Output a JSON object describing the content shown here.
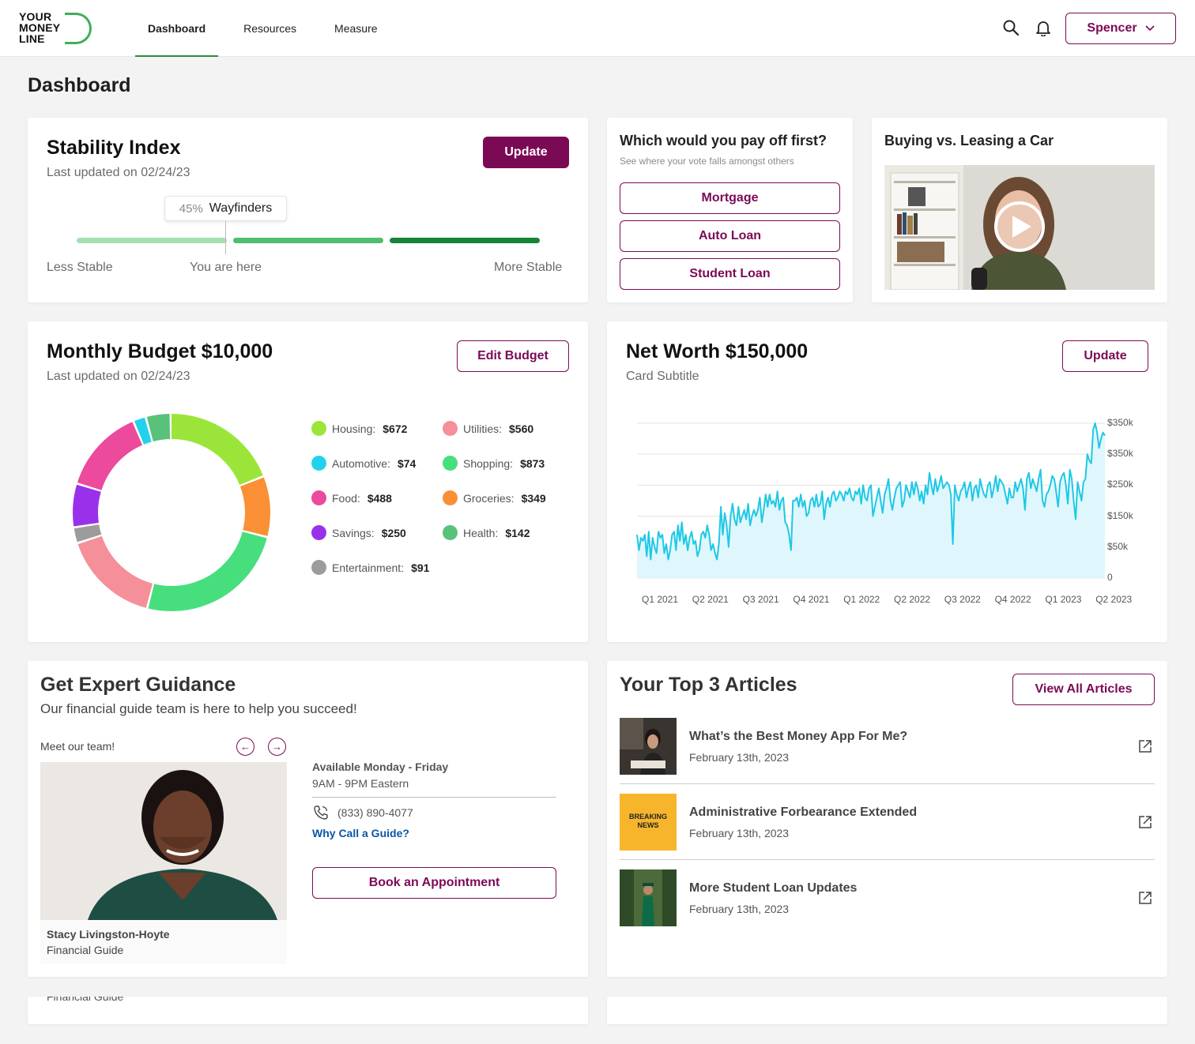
{
  "header": {
    "logo_lines": [
      "YOUR",
      "MONEY",
      "LINE"
    ],
    "nav": [
      "Dashboard",
      "Resources",
      "Measure"
    ],
    "user_name": "Spencer",
    "brand_color": "#7b0a55",
    "accent_color": "#2e8b46"
  },
  "page_title": "Dashboard",
  "stability": {
    "title": "Stability Index",
    "updated": "Last updated on 02/24/23",
    "button": "Update",
    "tooltip_pct": "45%",
    "tooltip_label": "Wayfinders",
    "position_fraction": 0.45,
    "less": "Less Stable",
    "here": "You are here",
    "more": "More Stable"
  },
  "vote": {
    "title": "Which would you pay off first?",
    "subtitle": "See where your vote falls amongst others",
    "options": [
      "Mortgage",
      "Auto Loan",
      "Student Loan"
    ]
  },
  "video": {
    "title": "Buying vs. Leasing a Car",
    "icon": "play-icon"
  },
  "budget": {
    "title": "Monthly Budget $10,000",
    "updated": "Last updated on 02/24/23",
    "button": "Edit Budget",
    "items": [
      {
        "label": "Housing:",
        "value": "$672",
        "color": "#9be53a"
      },
      {
        "label": "Utilities:",
        "value": "$560",
        "color": "#f58f9a"
      },
      {
        "label": "Automotive:",
        "value": "$74",
        "color": "#22d2ec"
      },
      {
        "label": "Shopping:",
        "value": "$873",
        "color": "#47df7d"
      },
      {
        "label": "Food:",
        "value": "$488",
        "color": "#ec4a9c"
      },
      {
        "label": "Groceries:",
        "value": "$349",
        "color": "#fa8f35"
      },
      {
        "label": "Savings:",
        "value": "$250",
        "color": "#9a31ea"
      },
      {
        "label": "Health:",
        "value": "$142",
        "color": "#58c27a"
      },
      {
        "label": "Entertainment:",
        "value": "$91",
        "color": "#9c9c9c"
      }
    ]
  },
  "networth": {
    "title": "Net Worth $150,000",
    "subtitle": "Card Subtitle",
    "button": "Update"
  },
  "chart_data": {
    "type": "area",
    "title": "",
    "xlabel": "",
    "ylabel": "",
    "x_ticks": [
      "Q1 2021",
      "Q2 2021",
      "Q3 2021",
      "Q4 2021",
      "Q1 2022",
      "Q2 2022",
      "Q3 2022",
      "Q4 2022",
      "Q1 2023",
      "Q2 2023"
    ],
    "y_tick_labels": [
      "0",
      "$50k",
      "$150k",
      "$250k",
      "$350k",
      "$350k"
    ],
    "y_tick_values": [
      0,
      50000,
      100000,
      150000,
      200000,
      250000
    ],
    "ylim": [
      0,
      255000
    ],
    "grid": true,
    "line_color": "#1fc8e6",
    "fill_color": "#dff7fc",
    "values": [
      70000,
      45000,
      65000,
      60000,
      70000,
      35000,
      75000,
      30000,
      65000,
      50000,
      40000,
      75000,
      65000,
      70000,
      40000,
      55000,
      30000,
      45000,
      70000,
      75000,
      45000,
      85000,
      60000,
      90000,
      55000,
      70000,
      45000,
      65000,
      75000,
      55000,
      60000,
      35000,
      45000,
      70000,
      75000,
      65000,
      85000,
      70000,
      45000,
      55000,
      40000,
      30000,
      55000,
      115000,
      70000,
      105000,
      85000,
      50000,
      100000,
      120000,
      95000,
      85000,
      115000,
      90000,
      100000,
      110000,
      95000,
      120000,
      85000,
      100000,
      110000,
      100000,
      110000,
      130000,
      90000,
      110000,
      135000,
      115000,
      135000,
      120000,
      125000,
      115000,
      140000,
      110000,
      125000,
      130000,
      90000,
      85000,
      70000,
      45000,
      125000,
      125000,
      130000,
      115000,
      135000,
      115000,
      125000,
      100000,
      105000,
      125000,
      130000,
      115000,
      135000,
      115000,
      120000,
      140000,
      95000,
      120000,
      130000,
      115000,
      135000,
      140000,
      125000,
      130000,
      140000,
      135000,
      125000,
      140000,
      135000,
      145000,
      130000,
      125000,
      140000,
      135000,
      145000,
      120000,
      150000,
      130000,
      125000,
      145000,
      150000,
      100000,
      115000,
      130000,
      145000,
      125000,
      105000,
      135000,
      145000,
      160000,
      125000,
      110000,
      130000,
      145000,
      150000,
      155000,
      115000,
      125000,
      150000,
      140000,
      130000,
      155000,
      135000,
      155000,
      145000,
      125000,
      140000,
      120000,
      150000,
      135000,
      170000,
      150000,
      135000,
      160000,
      140000,
      150000,
      165000,
      145000,
      150000,
      155000,
      150000,
      135000,
      55000,
      150000,
      135000,
      125000,
      140000,
      145000,
      155000,
      130000,
      145000,
      155000,
      125000,
      145000,
      150000,
      130000,
      160000,
      145000,
      135000,
      130000,
      150000,
      155000,
      130000,
      145000,
      165000,
      140000,
      160000,
      155000,
      150000,
      135000,
      120000,
      145000,
      130000,
      130000,
      155000,
      140000,
      150000,
      160000,
      145000,
      110000,
      160000,
      170000,
      145000,
      160000,
      150000,
      140000,
      160000,
      175000,
      125000,
      115000,
      135000,
      140000,
      150000,
      165000,
      160000,
      140000,
      115000,
      155000,
      165000,
      170000,
      150000,
      120000,
      175000,
      160000,
      125000,
      95000,
      155000,
      140000,
      125000,
      155000,
      160000,
      200000,
      190000,
      185000,
      240000,
      250000,
      235000,
      210000,
      225000,
      235000,
      230000
    ]
  },
  "guidance": {
    "title": "Get Expert Guidance",
    "subtitle": "Our financial guide team is here to help you succeed!",
    "meet": "Meet our team!",
    "guide_name": "Stacy Livingston-Hoyte",
    "guide_role": "Financial Guide",
    "available": "Available Monday - Friday",
    "hours": "9AM - 9PM Eastern",
    "phone": "(833) 890-4077",
    "why": "Why Call a Guide?",
    "button": "Book an Appointment",
    "ghost_role": "Financial Guide"
  },
  "articles": {
    "title": "Your Top 3 Articles",
    "button": "View All Articles",
    "items": [
      {
        "title": "What’s the Best Money App For Me?",
        "date": "February 13th, 2023"
      },
      {
        "title": "Administrative Forbearance Extended",
        "date": "February 13th, 2023",
        "thumb_text": "BREAKING NEWS"
      },
      {
        "title": "More Student Loan Updates",
        "date": "February 13th, 2023"
      }
    ]
  }
}
